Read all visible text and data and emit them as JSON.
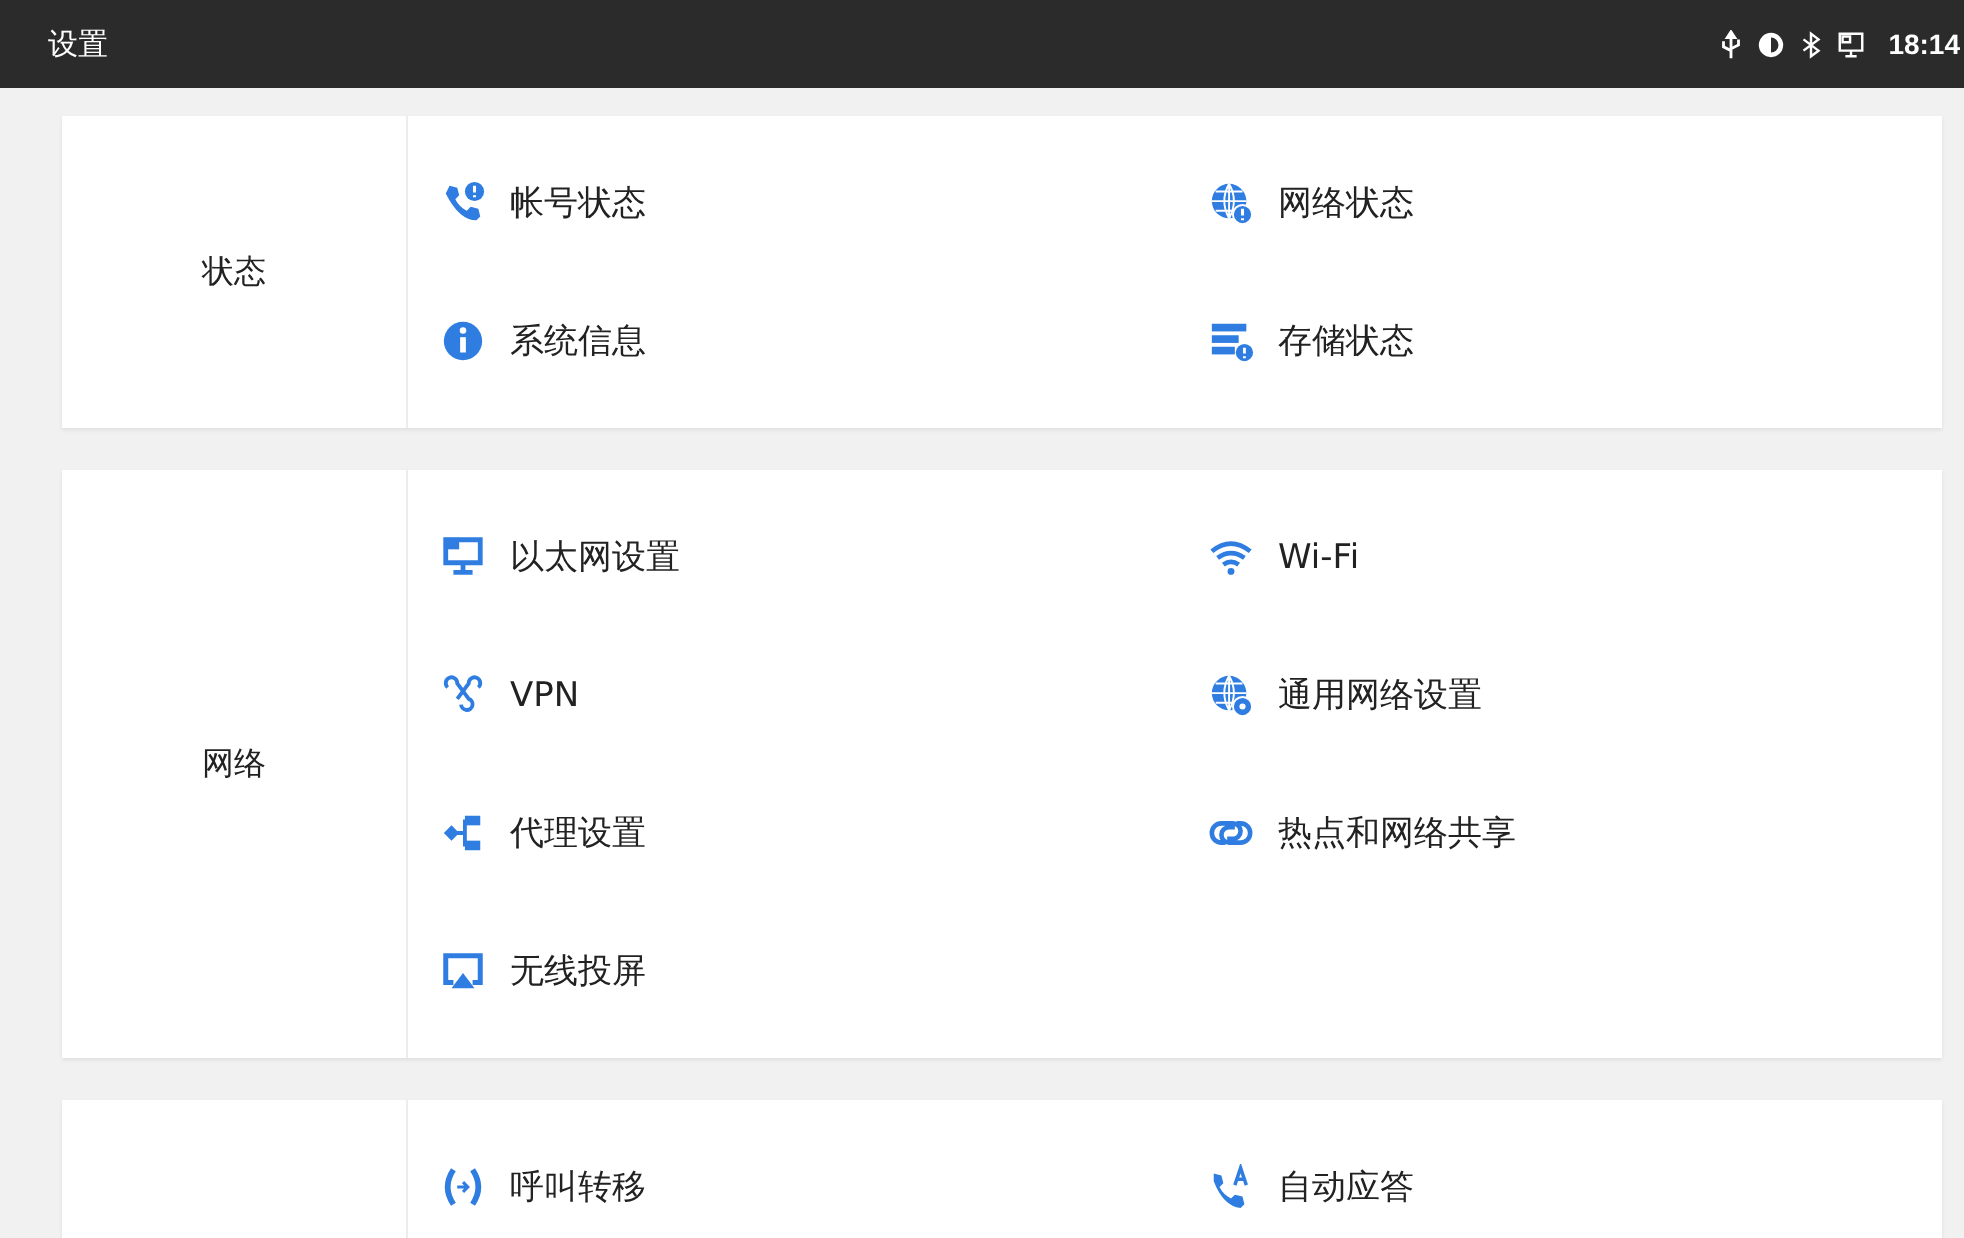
{
  "status_bar": {
    "title": "设置",
    "time": "18:14"
  },
  "sections": [
    {
      "label": "状态",
      "items": [
        {
          "kind": "phone-alert",
          "label": "帐号状态"
        },
        {
          "kind": "globe-alert",
          "label": "网络状态"
        },
        {
          "kind": "info",
          "label": "系统信息"
        },
        {
          "kind": "storage-alert",
          "label": "存储状态"
        }
      ]
    },
    {
      "label": "网络",
      "items": [
        {
          "kind": "monitor",
          "label": "以太网设置"
        },
        {
          "kind": "wifi",
          "label": "Wi-Fi"
        },
        {
          "kind": "vpn",
          "label": "VPN"
        },
        {
          "kind": "globe-gear",
          "label": "通用网络设置"
        },
        {
          "kind": "proxy",
          "label": "代理设置"
        },
        {
          "kind": "link",
          "label": "热点和网络共享"
        },
        {
          "kind": "cast",
          "label": "无线投屏"
        }
      ]
    },
    {
      "items": [
        {
          "kind": "call-forward",
          "label": "呼叫转移"
        },
        {
          "kind": "phone-a",
          "label": "自动应答"
        }
      ]
    }
  ]
}
